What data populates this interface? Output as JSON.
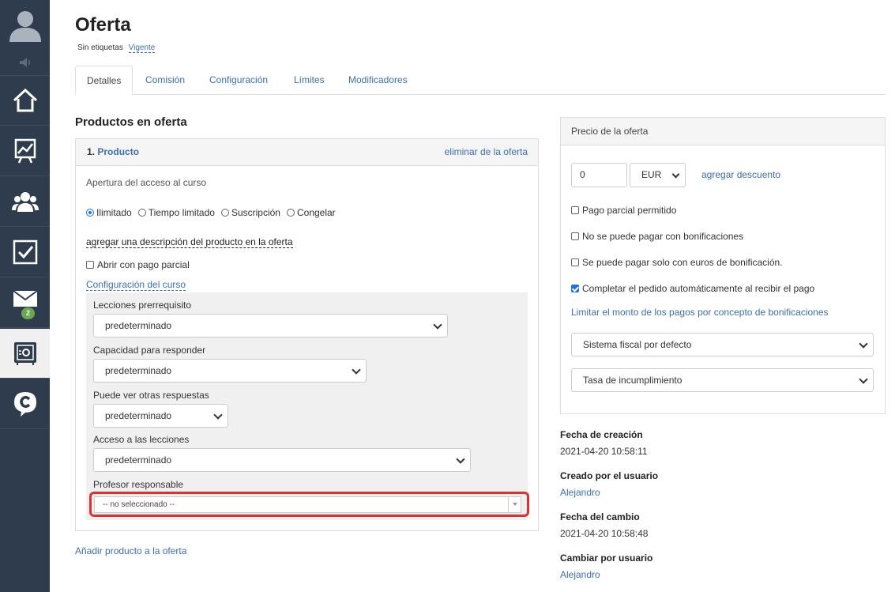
{
  "page": {
    "title": "Oferta",
    "tags_text": "Sin etiquetas",
    "status": "Vigente"
  },
  "tabs": [
    {
      "label": "Detalles"
    },
    {
      "label": "Comisión"
    },
    {
      "label": "Configuración"
    },
    {
      "label": "Límites"
    },
    {
      "label": "Modificadores"
    }
  ],
  "sidebar": {
    "mail_badge": "2"
  },
  "products": {
    "title": "Productos en oferta",
    "item_number": "1.",
    "item_name": "Producto",
    "remove_label": "eliminar de la oferta",
    "access_opening_label": "Apertura del acceso al curso",
    "access_options": [
      "Ilimitado",
      "Tiempo limitado",
      "Suscripción",
      "Congelar"
    ],
    "add_description_label": "agregar una descripción del producto en la oferta",
    "partial_payment_label": "Abrir con pago parcial",
    "course_settings_link": "Configuración del curso",
    "fields": {
      "prereq_label": "Lecciones prerrequisito",
      "prereq_value": "predeterminado",
      "answer_label": "Capacidad para responder",
      "answer_value": "predeterminado",
      "see_answers_label": "Puede ver otras respuestas",
      "see_answers_value": "predeterminado",
      "lesson_access_label": "Acceso a las lecciones",
      "lesson_access_value": "predeterminado",
      "teacher_label": "Profesor responsable",
      "teacher_value": "-- no seleccionado --"
    },
    "add_product_label": "Añadir producto a la oferta"
  },
  "price": {
    "title": "Precio de la oferta",
    "amount": "0",
    "currency": "EUR",
    "add_discount_label": "agregar descuento",
    "checks": [
      {
        "label": "Pago parcial permitido",
        "checked": false
      },
      {
        "label": "No se puede pagar con bonificaciones",
        "checked": false
      },
      {
        "label": "Se puede pagar solo con euros de bonificación.",
        "checked": false
      },
      {
        "label": "Completar el pedido automáticamente al recibir el pago",
        "checked": true
      }
    ],
    "limit_link": "Limitar el monto de los pagos por concepto de bonificaciones",
    "tax_system": "Sistema fiscal por defecto",
    "tax_rate": "Tasa de incumplimiento"
  },
  "meta": {
    "created_label": "Fecha de creación",
    "created_value": "2021-04-20 10:58:11",
    "created_by_label": "Creado por el usuario",
    "created_by_value": "Alejandro",
    "changed_label": "Fecha del cambio",
    "changed_value": "2021-04-20 10:58:48",
    "changed_by_label": "Cambiar por usuario",
    "changed_by_value": "Alejandro"
  }
}
